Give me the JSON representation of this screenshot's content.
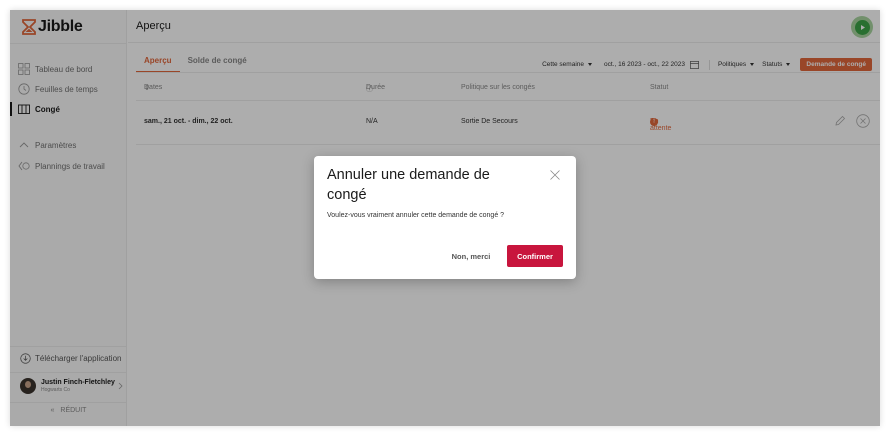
{
  "app": {
    "logo_text": "Jibble",
    "page_title": "Aperçu"
  },
  "sidebar": {
    "items": [
      {
        "label": "Tableau de bord",
        "icon": "grid-icon"
      },
      {
        "label": "Feuilles de temps",
        "icon": "clock-icon"
      },
      {
        "label": "Congé",
        "icon": "calendar-leave-icon",
        "active": true
      },
      {
        "label": "Paramètres",
        "icon": "chevron-up-icon"
      },
      {
        "label": "Plannings de travail",
        "icon": "schedule-icon"
      }
    ],
    "download_label": "Télécharger l'application",
    "user": {
      "name": "Justin Finch-Fletchley",
      "org": "Hogwarts Co"
    },
    "collapse_label": "RÉDUIT"
  },
  "tabs": [
    {
      "label": "Aperçu",
      "active": true
    },
    {
      "label": "Solde de congé",
      "active": false
    }
  ],
  "filters": {
    "period": "Cette semaine",
    "date_range": "oct., 16 2023 - oct., 22 2023",
    "policies": "Politiques",
    "statuses": "Statuts",
    "request_button": "Demande de congé"
  },
  "table": {
    "headers": {
      "dates": "Dates",
      "duration": "Durée",
      "policy": "Politique sur les congés",
      "status": "Statut"
    },
    "rows": [
      {
        "dates": "sam., 21 oct. - dim., 22 oct.",
        "duration": "N/A",
        "policy": "Sortie De Secours",
        "status": "En attente"
      }
    ]
  },
  "modal": {
    "title": "Annuler une demande de congé",
    "body": "Voulez-vous vraiment annuler cette demande de congé ?",
    "cancel_label": "Non, merci",
    "confirm_label": "Confirmer"
  },
  "colors": {
    "accent": "#e2673c",
    "confirm": "#c8153d",
    "play": "#3ca447"
  }
}
